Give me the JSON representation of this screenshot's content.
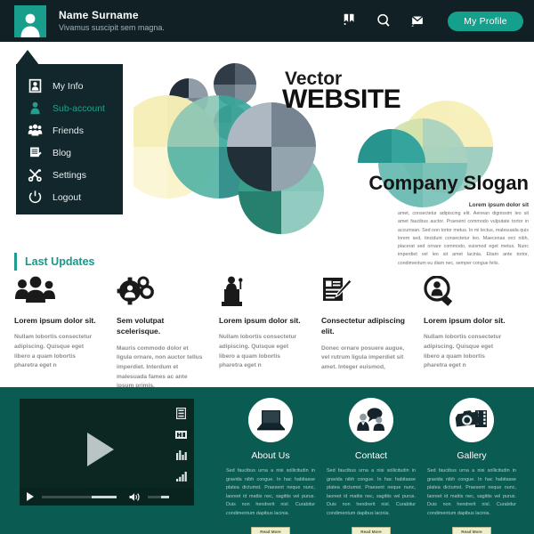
{
  "header": {
    "avatar_icon": "user-avatar-icon",
    "user_name": "Name Surname",
    "user_tagline": "Vivamus suscipit sem magna.",
    "icons": [
      {
        "name": "ribbon-icon",
        "label": "Favorites"
      },
      {
        "name": "search-icon",
        "label": "Search"
      },
      {
        "name": "mail-icon",
        "label": "Messages",
        "badge": "2"
      }
    ],
    "profile_button": "My Profile",
    "bg_color": "#102024",
    "accent_color": "#14a08c"
  },
  "sidebar": {
    "bg_color": "#12272b",
    "active_color": "#21a08f",
    "items": [
      {
        "label": "My Info",
        "icon": "id-card-icon",
        "active": false
      },
      {
        "label": "Sub-account",
        "icon": "person-icon",
        "active": true
      },
      {
        "label": "Friends",
        "icon": "people-icon",
        "active": false
      },
      {
        "label": "Blog",
        "icon": "documents-icon",
        "active": false
      },
      {
        "label": "Settings",
        "icon": "tools-icon",
        "active": false
      },
      {
        "label": "Logout",
        "icon": "power-icon",
        "active": false
      }
    ]
  },
  "hero": {
    "eyebrow": "Vector",
    "title": "WEBSITE",
    "slogan": "Company Slogan",
    "body_title": "Lorem ipsum dolor sit",
    "body_text": "amet, consectetur adipiscing elit. Aenean dignissim leo sit amet faucibus auctor. Praesent commodo vulputate tortor in accumsan. Sed non tortor metus. In mi lectus, malesuada quis lorem sed, tincidunt consectetur leo. Maecenas orci nibh, placerat sed ornare commodo, euismod eget metus. Nunc imperdiet vel leo sit amet lacinia. Etiam ante tortor, condimentum eu diam nec, semper congue felis.",
    "palette": [
      "#f4efb4",
      "#f7f2c2",
      "#7bc0b0",
      "#1b8f86",
      "#14786f",
      "#17242f",
      "#6f7d8c",
      "#9aa7b2",
      "#8fc9bd",
      "#b8dbd2",
      "#cfe3b2"
    ]
  },
  "updates": {
    "section_title": "Last Updates",
    "accent_color": "#16988a",
    "columns": [
      {
        "icon": "people-group-icon",
        "title": "Lorem ipsum dolor sit.",
        "text": "Nullam lobortis consectetur adipiscing. Quisque eget libero a quam lobortis pharetra eget n"
      },
      {
        "icon": "gears-user-icon",
        "title": "Sem volutpat scelerisque.",
        "text": "Mauris commodo dolor et ligula ornare, non auctor tellus imperdiet. Interdum et malesuada fames ac ante ipsum primis."
      },
      {
        "icon": "podium-speaker-icon",
        "title": "Lorem ipsum dolor sit.",
        "text": "Nullam lobortis consectetur adipiscing. Quisque eget libero a quam lobortis pharetra eget n"
      },
      {
        "icon": "form-pen-icon",
        "title": "Consectetur adipiscing elit.",
        "text": "Donec ornare posuere augue, vel rutrum ligula imperdiet sit amet. Integer euismod,"
      },
      {
        "icon": "user-search-icon",
        "title": "Lorem ipsum dolor sit.",
        "text": "Nullam lobortis consectetur adipiscing. Quisque eget libero a quam lobortis pharetra eget n"
      }
    ]
  },
  "bottom": {
    "bg_color": "#0a5b52",
    "video": {
      "play_icon": "play-triangle-icon",
      "controls": {
        "play": "play-icon",
        "volume": "volume-icon",
        "seek_value": "75",
        "volume_value": "60"
      },
      "side_icons": [
        "list-icon",
        "hd-badge-icon",
        "equalizer-icon",
        "signal-bars-icon"
      ]
    },
    "cards": [
      {
        "icon": "laptop-icon",
        "title": "About Us",
        "text": "Sed faucibus urna a nisi sollicitudin in gravida nibh congue. In hac habitasse platea dictumst. Praesent neque nunc, laoreet id mattis nec, sagittis vel purus. Duis non hendrerit nisl. Curabitur condimentum dapibus lacinia.",
        "button": "Read More"
      },
      {
        "icon": "people-chat-icon",
        "title": "Contact",
        "text": "Sed faucibus urna a nisi sollicitudin in gravida nibh congue. In hac habitasse platea dictumst. Praesent neque nunc, laoreet id mattis nec, sagittis vel purus. Duis non hendrerit nisl. Curabitur condimentum dapibus lacinia.",
        "button": "Read More"
      },
      {
        "icon": "camera-film-icon",
        "title": "Gallery",
        "text": "Sed faucibus urna a nisi sollicitudin in gravida nibh congue. In hac habitasse platea dictumst. Praesent neque nunc, laoreet id mattis nec, sagittis vel purus. Duis non hendrerit nisl. Curabitur condimentum dapibus lacinia.",
        "button": "Read More"
      }
    ]
  }
}
